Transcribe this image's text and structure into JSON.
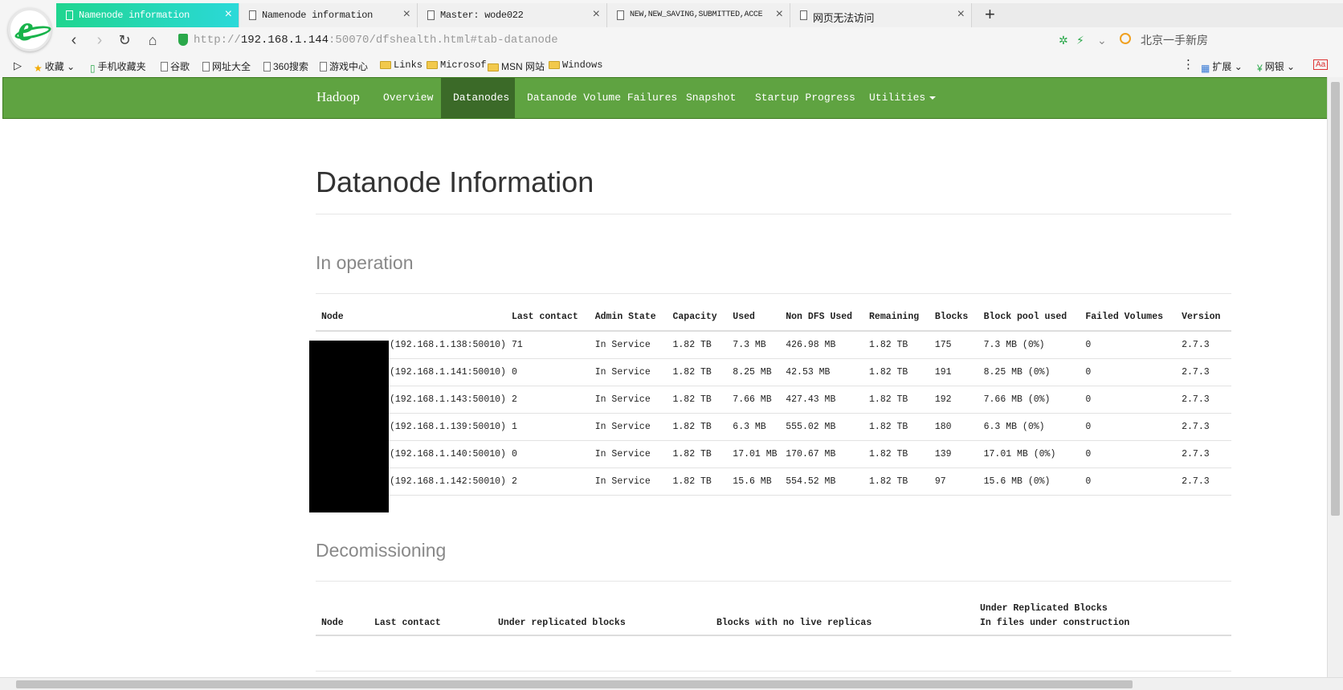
{
  "browser": {
    "tabs": [
      {
        "label": "Namenode information",
        "active": true
      },
      {
        "label": "Namenode information",
        "active": false
      },
      {
        "label": "Master: wode022",
        "active": false
      },
      {
        "label": "NEW,NEW_SAVING,SUBMITTED,ACCE",
        "active": false
      },
      {
        "label": "网页无法访问",
        "active": false
      }
    ],
    "new_tab": "+",
    "url_prefix": "http://",
    "url_host": "192.168.1.144",
    "url_path": ":50070/dfshealth.html#tab-datanode",
    "search_text": "北京一手新房",
    "bookmarks": [
      {
        "label": "收藏",
        "icon": "star-icon"
      },
      {
        "label": "手机收藏夹",
        "icon": "phone-icon"
      },
      {
        "label": "谷歌",
        "icon": "page-icon"
      },
      {
        "label": "网址大全",
        "icon": "page-icon"
      },
      {
        "label": "360搜索",
        "icon": "page-icon"
      },
      {
        "label": "游戏中心",
        "icon": "page-icon"
      },
      {
        "label": "Links",
        "icon": "folder-icon"
      },
      {
        "label": "Microsof",
        "icon": "folder-icon"
      },
      {
        "label": "MSN 网站",
        "icon": "folder-icon"
      },
      {
        "label": "Windows",
        "icon": "folder-icon"
      }
    ],
    "bm_right": {
      "extensions": "扩展",
      "bank": "网银"
    }
  },
  "navbar": {
    "brand": "Hadoop",
    "items": [
      "Overview",
      "Datanodes",
      "Datanode Volume Failures",
      "Snapshot",
      "Startup Progress",
      "Utilities"
    ],
    "active": "Datanodes"
  },
  "page": {
    "title": "Datanode Information",
    "in_operation": "In operation",
    "decommissioning": "Decomissioning"
  },
  "op_table": {
    "headers": [
      "Node",
      "Last contact",
      "Admin State",
      "Capacity",
      "Used",
      "Non DFS Used",
      "Remaining",
      "Blocks",
      "Block pool used",
      "Failed Volumes",
      "Version"
    ],
    "rows": [
      [
        "(192.168.1.138:50010)",
        "71",
        "In Service",
        "1.82 TB",
        "7.3 MB",
        "426.98 MB",
        "1.82 TB",
        "175",
        "7.3 MB (0%)",
        "0",
        "2.7.3"
      ],
      [
        "(192.168.1.141:50010)",
        "0",
        "In Service",
        "1.82 TB",
        "8.25 MB",
        "42.53 MB",
        "1.82 TB",
        "191",
        "8.25 MB (0%)",
        "0",
        "2.7.3"
      ],
      [
        "(192.168.1.143:50010)",
        "2",
        "In Service",
        "1.82 TB",
        "7.66 MB",
        "427.43 MB",
        "1.82 TB",
        "192",
        "7.66 MB (0%)",
        "0",
        "2.7.3"
      ],
      [
        "(192.168.1.139:50010)",
        "1",
        "In Service",
        "1.82 TB",
        "6.3 MB",
        "555.02 MB",
        "1.82 TB",
        "180",
        "6.3 MB (0%)",
        "0",
        "2.7.3"
      ],
      [
        "(192.168.1.140:50010)",
        "0",
        "In Service",
        "1.82 TB",
        "17.01 MB",
        "170.67 MB",
        "1.82 TB",
        "139",
        "17.01 MB (0%)",
        "0",
        "2.7.3"
      ],
      [
        "(192.168.1.142:50010)",
        "2",
        "In Service",
        "1.82 TB",
        "15.6 MB",
        "554.52 MB",
        "1.82 TB",
        "97",
        "15.6 MB (0%)",
        "0",
        "2.7.3"
      ]
    ]
  },
  "dec_table": {
    "headers": [
      "Node",
      "Last contact",
      "Under replicated blocks",
      "Blocks with no live replicas"
    ],
    "last_header_line1": "Under Replicated Blocks",
    "last_header_line2": "In files under construction"
  },
  "colors": {
    "navbar": "#5fa341",
    "navbar_active": "#3b6a28",
    "tab_active": "#1fd58f"
  }
}
